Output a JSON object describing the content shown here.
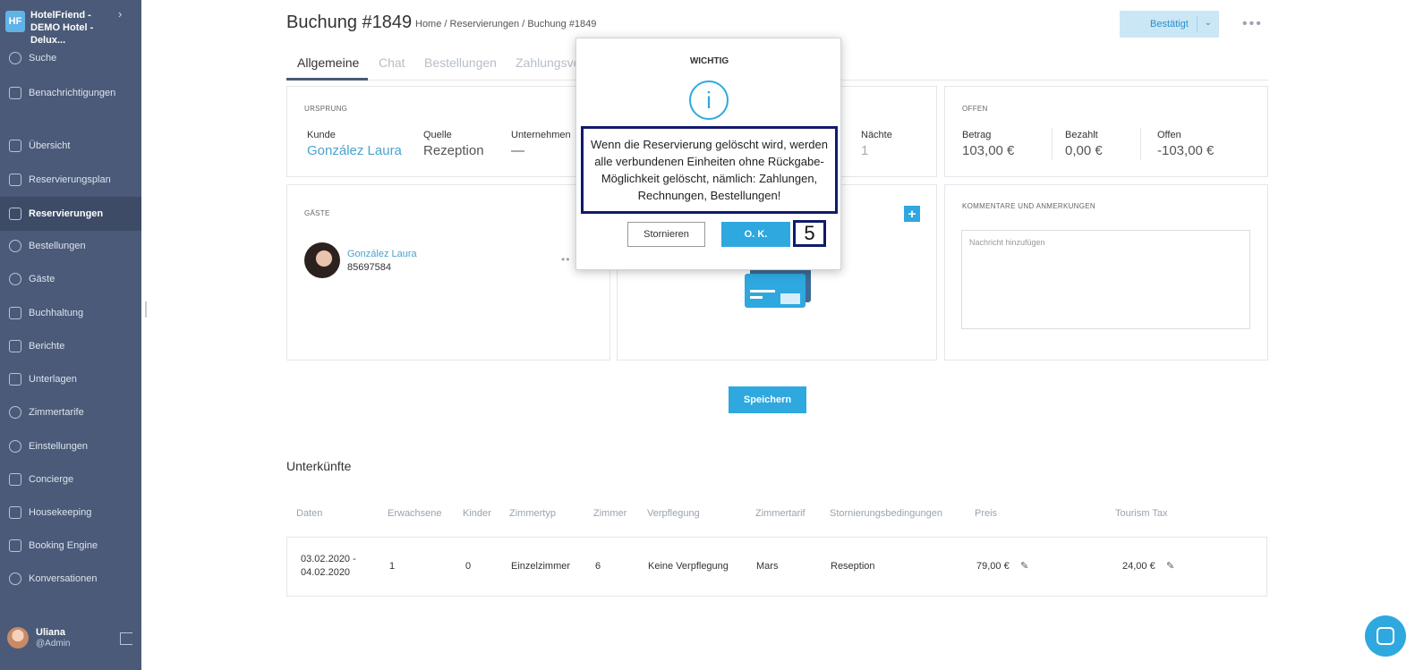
{
  "sidebar": {
    "brand": "HotelFriend - DEMO Hotel - Delux...",
    "brand_logo": "HF",
    "items": [
      {
        "label": "Suche",
        "icon": "search-icon"
      },
      {
        "label": "Benachrichtigungen",
        "icon": "bell-icon"
      },
      {
        "label": "Übersicht",
        "icon": "home-icon"
      },
      {
        "label": "Reservierungsplan",
        "icon": "calendar-icon"
      },
      {
        "label": "Reservierungen",
        "icon": "clipboard-icon",
        "active": true
      },
      {
        "label": "Bestellungen",
        "icon": "cloche-icon"
      },
      {
        "label": "Gäste",
        "icon": "user-icon"
      },
      {
        "label": "Buchhaltung",
        "icon": "calculator-icon"
      },
      {
        "label": "Berichte",
        "icon": "report-icon"
      },
      {
        "label": "Unterlagen",
        "icon": "folder-icon"
      },
      {
        "label": "Zimmertarife",
        "icon": "tag-icon"
      },
      {
        "label": "Einstellungen",
        "icon": "gear-icon"
      },
      {
        "label": "Concierge",
        "icon": "concierge-icon"
      },
      {
        "label": "Housekeeping",
        "icon": "broom-icon"
      },
      {
        "label": "Booking Engine",
        "icon": "monitor-icon"
      },
      {
        "label": "Konversationen",
        "icon": "chat-icon"
      }
    ],
    "user": {
      "name": "Uliana",
      "role": "@Admin"
    }
  },
  "header": {
    "title": "Buchung #1849",
    "breadcrumb": "Home / Reservierungen / Buchung #1849",
    "status": "Bestätigt"
  },
  "tabs": [
    "Allgemeine",
    "Chat",
    "Bestellungen",
    "Zahlungsve"
  ],
  "origin": {
    "label": "URSPRUNG",
    "kunde_label": "Kunde",
    "kunde": "González Laura",
    "quelle_label": "Quelle",
    "quelle": "Rezeption",
    "unternehmen_label": "Unternehmen",
    "unternehmen": "—"
  },
  "stay": {
    "naechte_label": "Nächte",
    "naechte": "1"
  },
  "open": {
    "label": "OFFEN",
    "betrag_label": "Betrag",
    "betrag": "103,00 €",
    "bezahlt_label": "Bezahlt",
    "bezahlt": "0,00 €",
    "offen_label": "Offen",
    "offen": "-103,00 €"
  },
  "guests": {
    "label": "GÄSTE",
    "name": "González Laura",
    "phone": "85697584"
  },
  "comments": {
    "label": "KOMMENTARE UND ANMERKUNGEN",
    "placeholder": "Nachricht hinzufügen"
  },
  "save_label": "Speichern",
  "accommodations": {
    "title": "Unterkünfte",
    "columns": [
      "Daten",
      "Erwachsene",
      "Kinder",
      "Zimmertyp",
      "Zimmer",
      "Verpflegung",
      "Zimmertarif",
      "Stornierungsbedingungen",
      "Preis",
      "Tourism Tax"
    ],
    "row": {
      "date1": "03.02.2020 -",
      "date2": "04.02.2020",
      "adults": "1",
      "children": "0",
      "room_type": "Einzelzimmer",
      "room": "6",
      "board": "Keine Verpflegung",
      "rate": "Mars",
      "cancel": "Reseption",
      "price": "79,00 €",
      "tax": "24,00 €"
    }
  },
  "modal": {
    "title": "WICHTIG",
    "icon": "i",
    "message": "Wenn die Reservierung gelöscht wird, werden alle verbundenen Einheiten ohne Rückgabe-Möglichkeit gelöscht, nämlich: Zahlungen, Rechnungen, Bestellungen!",
    "cancel": "Stornieren",
    "ok": "O. K.",
    "step": "5"
  },
  "colors": {
    "sidebar": "#4a5a78",
    "accent": "#2ea8df",
    "annotation": "#111a6b"
  }
}
